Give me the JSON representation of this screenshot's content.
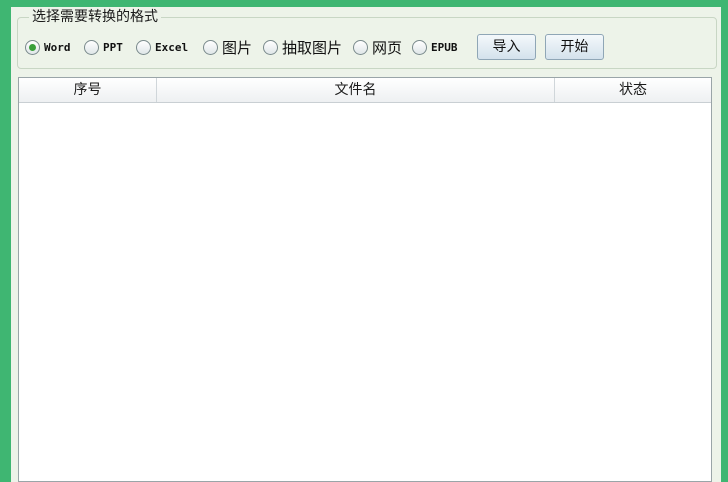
{
  "format_group": {
    "title": "选择需要转换的格式",
    "options": [
      {
        "label": "Word",
        "checked": true
      },
      {
        "label": "PPT",
        "checked": false
      },
      {
        "label": "Excel",
        "checked": false
      },
      {
        "label": "图片",
        "checked": false
      },
      {
        "label": "抽取图片",
        "checked": false
      },
      {
        "label": "网页",
        "checked": false
      },
      {
        "label": "EPUB",
        "checked": false
      }
    ],
    "import_label": "导入",
    "start_label": "开始"
  },
  "file_list": {
    "columns": [
      "序号",
      "文件名",
      "状态"
    ],
    "rows": []
  }
}
